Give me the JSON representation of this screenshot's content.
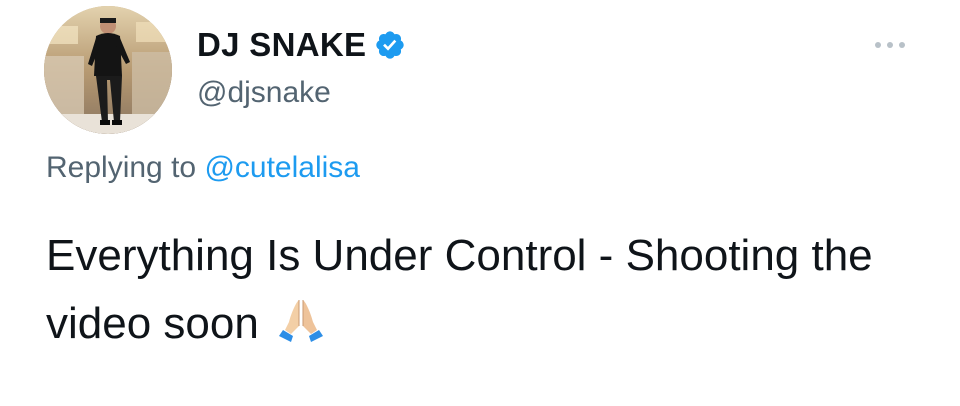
{
  "author": {
    "display_name": "DJ SNAKE",
    "handle": "@djsnake",
    "verified": true
  },
  "reply": {
    "prefix": "Replying to",
    "mention": "@cutelalisa"
  },
  "tweet": {
    "text": "Everything Is Under Control - Shooting the video soon",
    "emoji": "folded-hands"
  },
  "colors": {
    "link": "#1d9bf0",
    "secondary_text": "#536471",
    "primary_text": "#0f1419",
    "verified": "#1d9bf0"
  },
  "icons": {
    "verified": "verified-badge-icon",
    "more": "more-dots-icon",
    "emoji": "folded-hands-emoji"
  }
}
